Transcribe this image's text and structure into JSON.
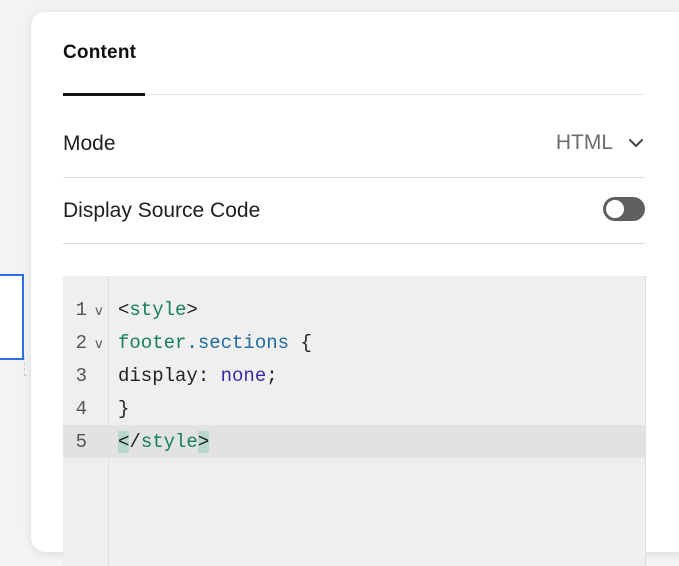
{
  "tabs": [
    {
      "label": "Content",
      "active": true
    }
  ],
  "mode": {
    "label": "Mode",
    "value": "HTML"
  },
  "source_code": {
    "label": "Display Source Code",
    "enabled": false
  },
  "editor": {
    "lines": [
      {
        "num": "1",
        "fold": "v"
      },
      {
        "num": "2",
        "fold": "v"
      },
      {
        "num": "3",
        "fold": ""
      },
      {
        "num": "4",
        "fold": ""
      },
      {
        "num": "5",
        "fold": ""
      }
    ],
    "tokens": {
      "l1_open": "<",
      "l1_tag": "style",
      "l1_close": ">",
      "l2_sel": "footer",
      "l2_cls": ".sections",
      "l2_brace": " {",
      "l3_prop": "display: ",
      "l3_val": "none",
      "l3_semi": ";",
      "l4_brace": "}",
      "l5_open": "<",
      "l5_slash": "/",
      "l5_tag": "style",
      "l5_close": ">"
    }
  },
  "colors": {
    "accent": "#111111",
    "toggle_off": "#5f5f5f",
    "code_tag": "#127f5e",
    "code_value": "#3b2ba3",
    "bracket_match": "#b9d6cf"
  }
}
